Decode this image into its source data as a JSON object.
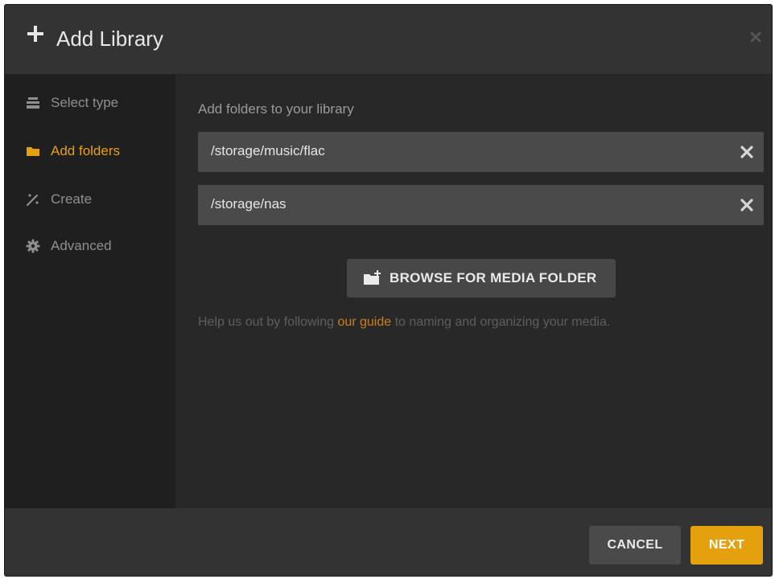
{
  "header": {
    "title": "Add Library",
    "icons": {
      "add": "plus-icon",
      "close": "close-icon"
    }
  },
  "sidebar": {
    "items": [
      {
        "label": "Select type",
        "icon": "stack-icon",
        "active": false
      },
      {
        "label": "Add folders",
        "icon": "folder-icon",
        "active": true
      },
      {
        "label": "Create",
        "icon": "magic-wand-icon",
        "active": false
      },
      {
        "label": "Advanced",
        "icon": "gear-icon",
        "active": false
      }
    ]
  },
  "main": {
    "section_label": "Add folders to your library",
    "folders": [
      {
        "path": "/storage/music/flac"
      },
      {
        "path": "/storage/nas"
      }
    ],
    "browse_label": "BROWSE FOR MEDIA FOLDER",
    "help": {
      "prefix": "Help us out by following ",
      "link": "our guide",
      "suffix": " to naming and organizing your media."
    }
  },
  "footer": {
    "cancel_label": "CANCEL",
    "next_label": "NEXT"
  },
  "colors": {
    "accent": "#e5a00d",
    "background": "#282828",
    "header": "#333333",
    "sidebar": "#1f1f1f"
  }
}
